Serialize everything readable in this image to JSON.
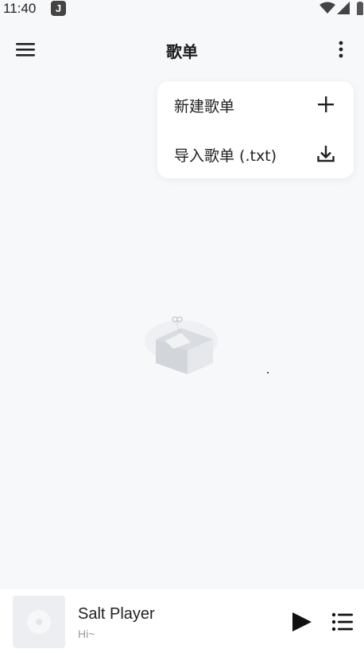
{
  "status_bar": {
    "time": "11:40",
    "app_icon_glyph": "J",
    "icons": [
      "wifi-icon",
      "cellular-signal-icon",
      "battery-icon"
    ]
  },
  "app_bar": {
    "title": "歌单",
    "menu_icon": "hamburger-menu-icon",
    "more_icon": "more-vertical-icon"
  },
  "dropdown": {
    "items": [
      {
        "label": "新建歌单",
        "icon": "plus-icon"
      },
      {
        "label": "导入歌单 (.txt)",
        "icon": "download-icon"
      }
    ]
  },
  "empty_state": {
    "illustration": "empty-box-illustration"
  },
  "mini_player": {
    "title": "Salt Player",
    "subtitle": "Hi~",
    "cover_icon": "disc-icon",
    "play_icon": "play-icon",
    "queue_icon": "queue-list-icon"
  },
  "colors": {
    "background": "#f7f8fa",
    "surface": "#ffffff",
    "text_primary": "#1c1c1e",
    "text_secondary": "#9a9a9a"
  }
}
